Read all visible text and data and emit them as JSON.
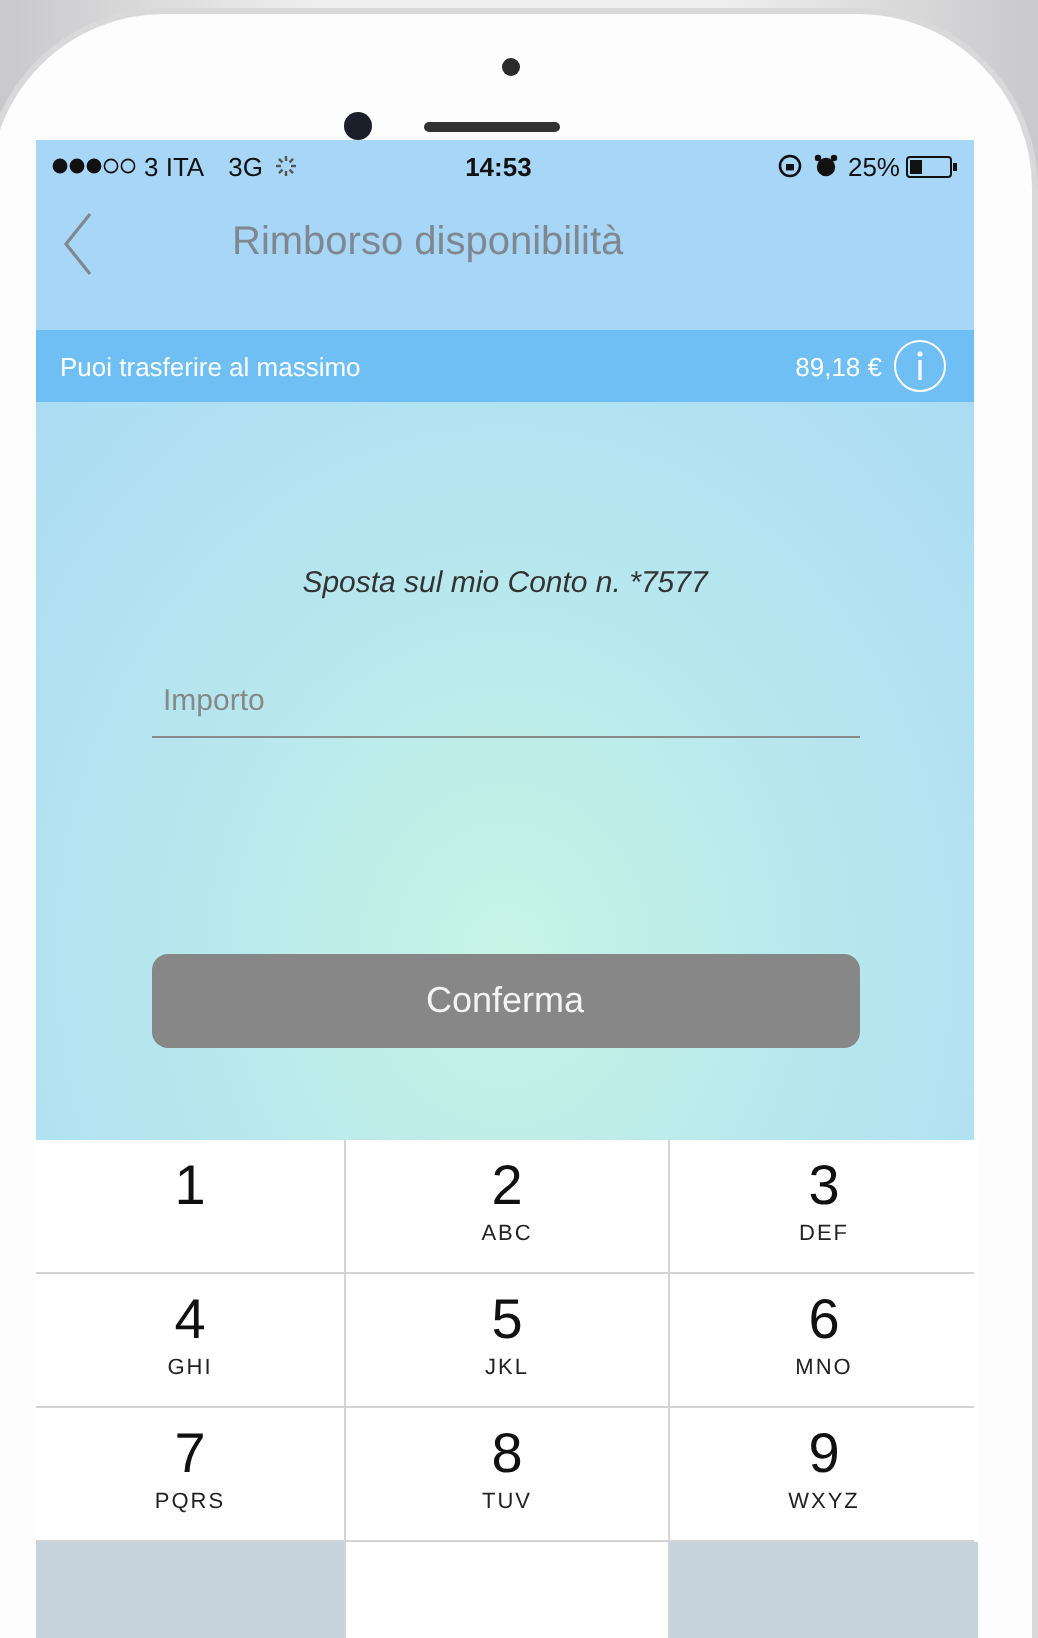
{
  "status_bar": {
    "carrier": "3 ITA",
    "network": "3G",
    "time": "14:53",
    "battery": "25%"
  },
  "nav": {
    "title": "Rimborso disponibilità"
  },
  "info_bar": {
    "label": "Puoi trasferire al massimo",
    "amount": "89,18 €"
  },
  "transfer": {
    "destination": "Sposta sul mio Conto n. *7577",
    "amount_field": {
      "placeholder": "Importo"
    },
    "confirm_button": "Conferma"
  },
  "keypad": {
    "keys": [
      {
        "digit": "1"
      },
      {
        "digit": "2",
        "letters": "ABC"
      },
      {
        "digit": "3",
        "letters": "DEF"
      },
      {
        "digit": "4",
        "letters": "GHI"
      },
      {
        "digit": "5",
        "letters": "JKL"
      },
      {
        "digit": "6",
        "letters": "MNO"
      },
      {
        "digit": "7",
        "letters": "PQRS"
      },
      {
        "digit": "8",
        "letters": "TUV"
      },
      {
        "digit": "9",
        "letters": "WXYZ"
      }
    ]
  }
}
